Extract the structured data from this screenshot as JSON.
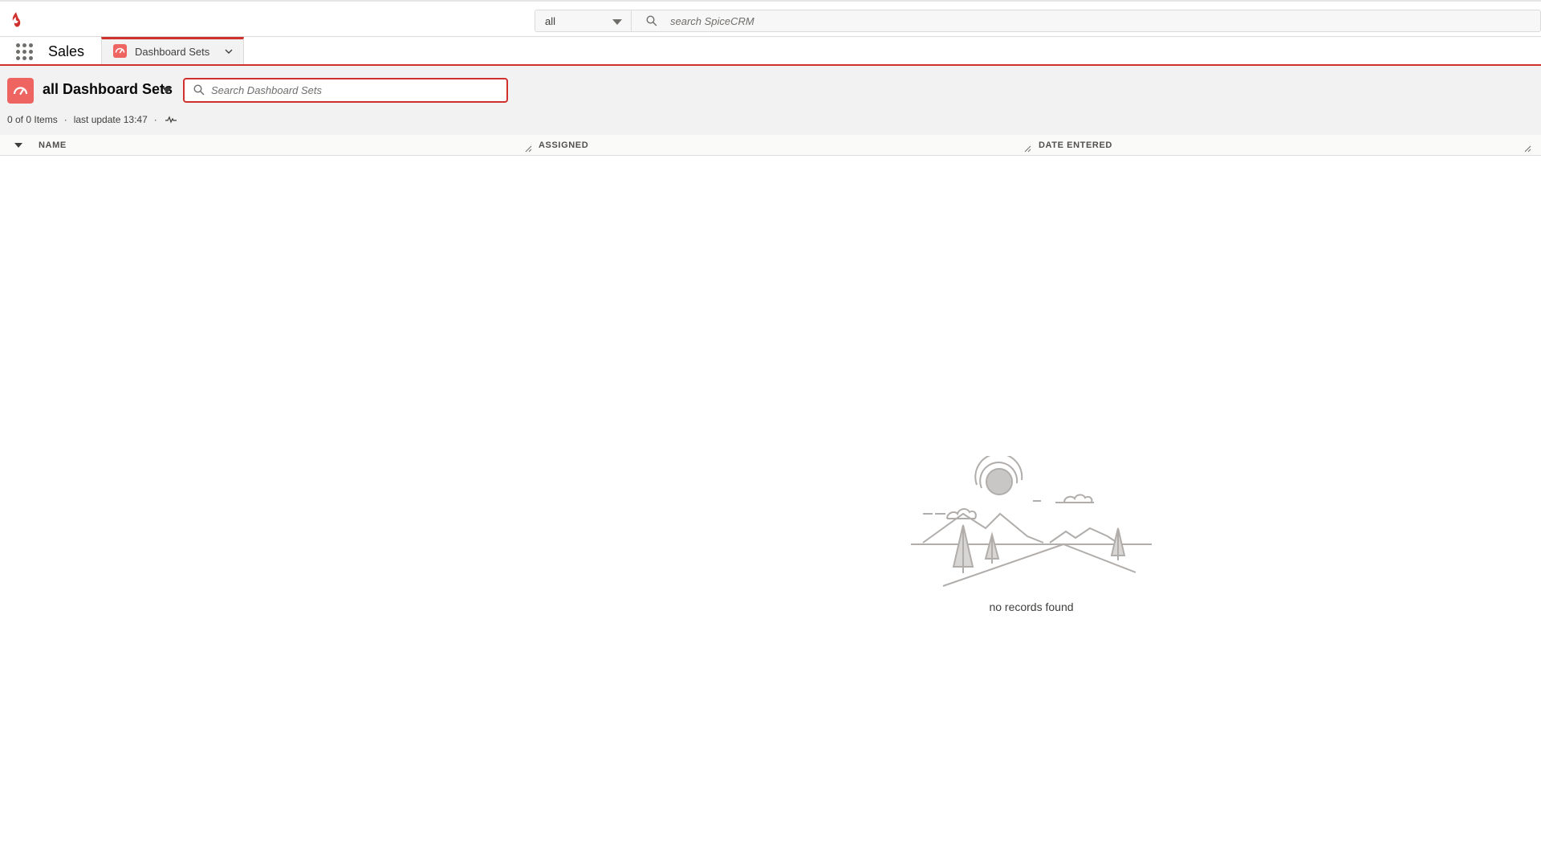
{
  "header": {
    "scope_value": "all",
    "search_placeholder": "search SpiceCRM"
  },
  "nav": {
    "app_name": "Sales",
    "tabs": [
      {
        "label": "Dashboard Sets"
      }
    ]
  },
  "list": {
    "title": "all Dashboard Sets",
    "search_placeholder": "Search Dashboard Sets",
    "item_count": "0 of 0 Items",
    "separator": "·",
    "last_update": "last update 13:47",
    "columns": [
      {
        "label": "NAME"
      },
      {
        "label": "ASSIGNED"
      },
      {
        "label": "DATE ENTERED"
      }
    ],
    "rows": [],
    "empty_message": "no records found"
  },
  "colors": {
    "accent": "#d0312d",
    "module_icon_bg": "#ee6461"
  },
  "icons": {
    "logo": "spicecrm-logo-icon",
    "global_search": "search-icon",
    "app_launcher": "waffle-icon",
    "module": "dashboard-sets-icon",
    "tab_menu": "chevron-down-icon",
    "activity": "activity-icon"
  }
}
